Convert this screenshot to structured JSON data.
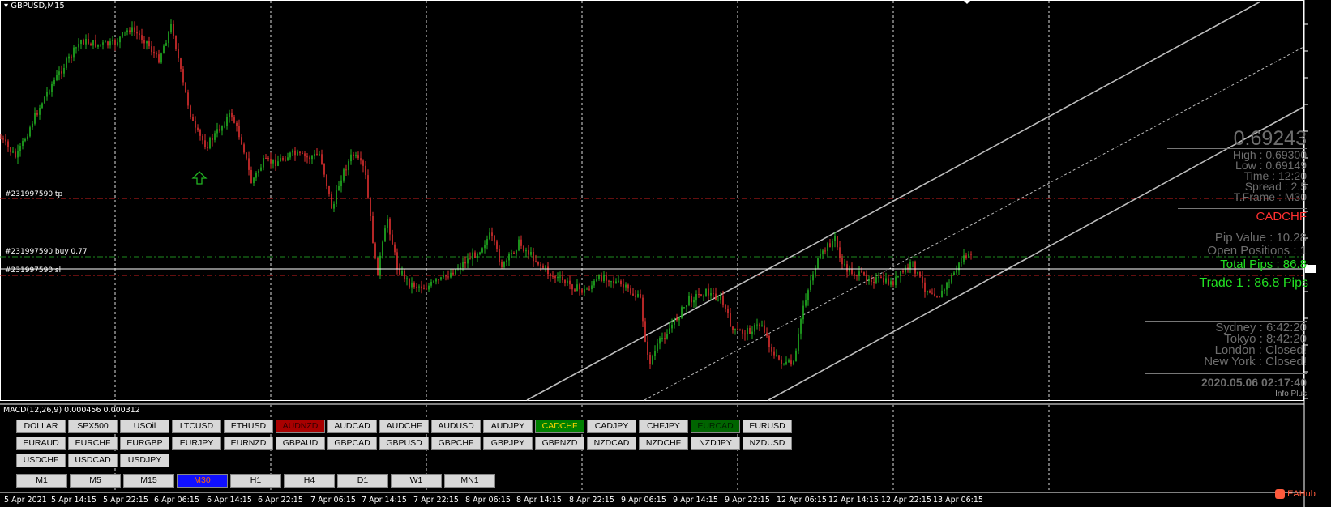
{
  "window": {
    "title": "GBPUSD,M15"
  },
  "chart_data": {
    "type": "candlestick",
    "symbol": "GBPUSD",
    "timeframe": "M15",
    "order_lines": [
      {
        "label": "#231997590 tp",
        "kind": "take-profit",
        "color": "#c81e1e"
      },
      {
        "label": "#231997590 buy 0.77",
        "kind": "entry",
        "color": "#1e8a1e"
      },
      {
        "label": "#231997590 sl",
        "kind": "stop-loss",
        "color": "#c81e1e"
      }
    ],
    "x_tick_labels": [
      "5 Apr 2021",
      "5 Apr 14:15",
      "5 Apr 22:15",
      "6 Apr 06:15",
      "6 Apr 14:15",
      "6 Apr 22:15",
      "7 Apr 06:15",
      "7 Apr 14:15",
      "7 Apr 22:15",
      "8 Apr 06:15",
      "8 Apr 14:15",
      "8 Apr 22:15",
      "9 Apr 06:15",
      "9 Apr 14:15",
      "9 Apr 22:15",
      "12 Apr 06:15",
      "12 Apr 14:15",
      "12 Apr 22:15",
      "13 Apr 06:15"
    ],
    "up_color": "#22b422",
    "down_color": "#e03030",
    "grid": true,
    "channel": "rising regression channel (white)"
  },
  "indicator": {
    "label": "MACD(12,26,9) 0.000456 0.000312"
  },
  "info_panel": {
    "price": "0.69243",
    "high": "High : 0.69300",
    "low": "Low : 0.69149",
    "time": "Time :   12:20",
    "spread": "Spread :    2.5",
    "tframe": "T.Frame :   M30",
    "symbol": "CADCHF",
    "pip_value": "Pip Value :   10.28",
    "open_positions": "Open Positions :     1",
    "total_pips": "Total Pips :    86.8",
    "trade1": "Trade 1 :    86.8 Pips",
    "sydney": "Sydney : 6:42:20",
    "tokyo": "Tokyo : 8:42:20",
    "london": "London : Closed!",
    "newyork": "New York : Closed!",
    "datetime": "2020.05.06 02:17:40",
    "brand": "Info Plus"
  },
  "symbol_buttons": {
    "row1": [
      "DOLLAR",
      "SPX500",
      "USOil",
      "LTCUSD",
      "ETHUSD",
      "AUDNZD",
      "AUDCAD",
      "AUDCHF",
      "AUDUSD",
      "AUDJPY",
      "CADCHF",
      "CADJPY",
      "CHFJPY",
      "EURCAD",
      "EURUSD"
    ],
    "row2": [
      "EURAUD",
      "EURCHF",
      "EURGBP",
      "EURJPY",
      "EURNZD",
      "GBPAUD",
      "GBPCAD",
      "GBPUSD",
      "GBPCHF",
      "GBPJPY",
      "GBPNZD",
      "NZDCAD",
      "NZDCHF",
      "NZDJPY",
      "NZDUSD"
    ],
    "row3": [
      "USDCHF",
      "USDCAD",
      "USDJPY"
    ]
  },
  "timeframe_buttons": [
    "M1",
    "M5",
    "M15",
    "M30",
    "H1",
    "H4",
    "D1",
    "W1",
    "MN1"
  ],
  "highlight_colors": {
    "AUDNZD": "red",
    "CADCHF": "green",
    "EURCAD": "dgreen",
    "M30": "blue"
  },
  "watermark": "EAHub"
}
